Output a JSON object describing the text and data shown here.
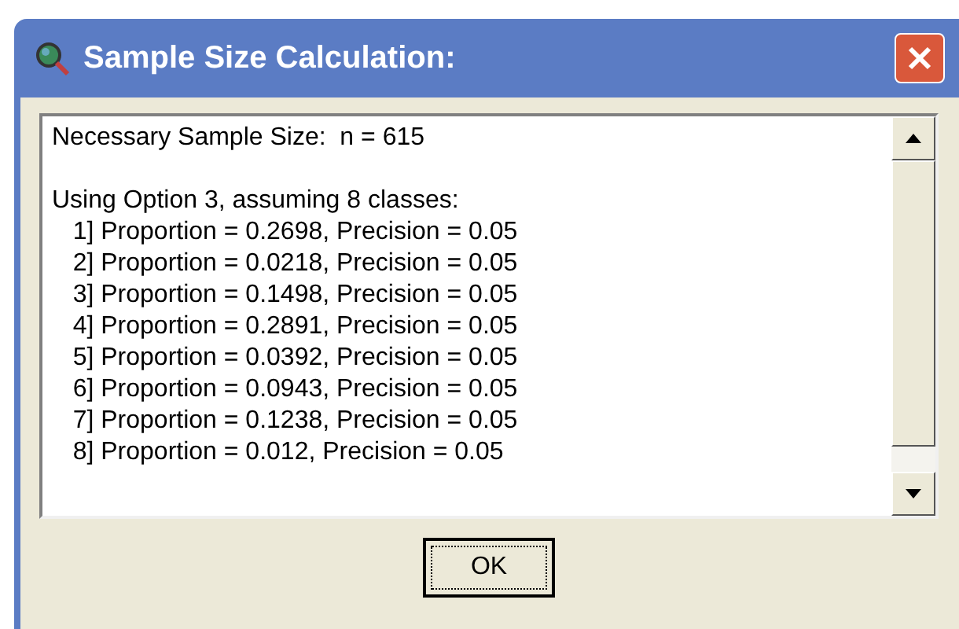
{
  "window": {
    "title": "Sample Size Calculation:"
  },
  "output": {
    "result": "Necessary Sample Size:  n = 615",
    "heading": "Using Option 3, assuming 8 classes:",
    "lines": [
      "   1] Proportion = 0.2698, Precision = 0.05",
      "   2] Proportion = 0.0218, Precision = 0.05",
      "   3] Proportion = 0.1498, Precision = 0.05",
      "   4] Proportion = 0.2891, Precision = 0.05",
      "   5] Proportion = 0.0392, Precision = 0.05",
      "   6] Proportion = 0.0943, Precision = 0.05",
      "   7] Proportion = 0.1238, Precision = 0.05",
      "   8] Proportion = 0.012, Precision = 0.05"
    ]
  },
  "buttons": [
    "OK"
  ]
}
